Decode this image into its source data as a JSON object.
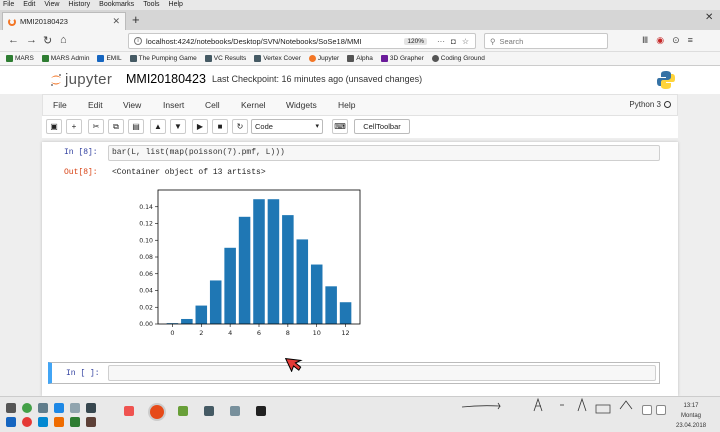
{
  "browser": {
    "menu": [
      "File",
      "Edit",
      "View",
      "History",
      "Bookmarks",
      "Tools",
      "Help"
    ],
    "tab_title": "MMI20180423",
    "new_tab": "+",
    "url": "localhost:4242/notebooks/Desktop/SVN/Notebooks/SoSe18/MMI",
    "zoom": "120%",
    "search_placeholder": "Search",
    "bookmarks": [
      {
        "label": "MARS",
        "color": "#2e7d32"
      },
      {
        "label": "MARS Admin",
        "color": "#2e7d32"
      },
      {
        "label": "EMIL",
        "color": "#1565c0"
      },
      {
        "label": "The Pumping Game",
        "color": "#455a64"
      },
      {
        "label": "VC Results",
        "color": "#455a64"
      },
      {
        "label": "Vertex Cover",
        "color": "#455a64"
      },
      {
        "label": "Jupyter",
        "color": "#f37626"
      },
      {
        "label": "Alpha",
        "color": "#555555"
      },
      {
        "label": "3D Grapher",
        "color": "#6a1b9a"
      },
      {
        "label": "Coding Ground",
        "color": "#555555"
      }
    ]
  },
  "jupyter": {
    "brand": "jupyter",
    "notebook_name": "MMI20180423",
    "checkpoint": "Last Checkpoint: 16 minutes ago (unsaved changes)",
    "menus": [
      "File",
      "Edit",
      "View",
      "Insert",
      "Cell",
      "Kernel",
      "Widgets",
      "Help"
    ],
    "kernel": "Python 3",
    "cell_type": "Code",
    "celltoolbar_label": "CellToolbar",
    "cells": [
      {
        "in_prompt": "In [8]:",
        "code": "bar(L, list(map(poisson(7).pmf, L)))",
        "out_prompt": "Out[8]:",
        "output": "<Container object of 13 artists>"
      },
      {
        "in_prompt": "In [ ]:",
        "code": ""
      }
    ]
  },
  "chart_data": {
    "type": "bar",
    "x": [
      0,
      1,
      2,
      3,
      4,
      5,
      6,
      7,
      8,
      9,
      10,
      11,
      12
    ],
    "values": [
      0.001,
      0.006,
      0.022,
      0.052,
      0.091,
      0.128,
      0.149,
      0.149,
      0.13,
      0.101,
      0.071,
      0.045,
      0.026
    ],
    "xticks": [
      "0",
      "2",
      "4",
      "6",
      "8",
      "10",
      "12"
    ],
    "yticks": [
      "0.00",
      "0.02",
      "0.04",
      "0.06",
      "0.08",
      "0.10",
      "0.12",
      "0.14"
    ],
    "ylim": [
      0,
      0.16
    ],
    "xlim": [
      -1,
      13
    ],
    "color": "#1f77b4"
  },
  "taskbar": {
    "time": "13:17",
    "day": "Montag",
    "date": "23.04.2018"
  }
}
